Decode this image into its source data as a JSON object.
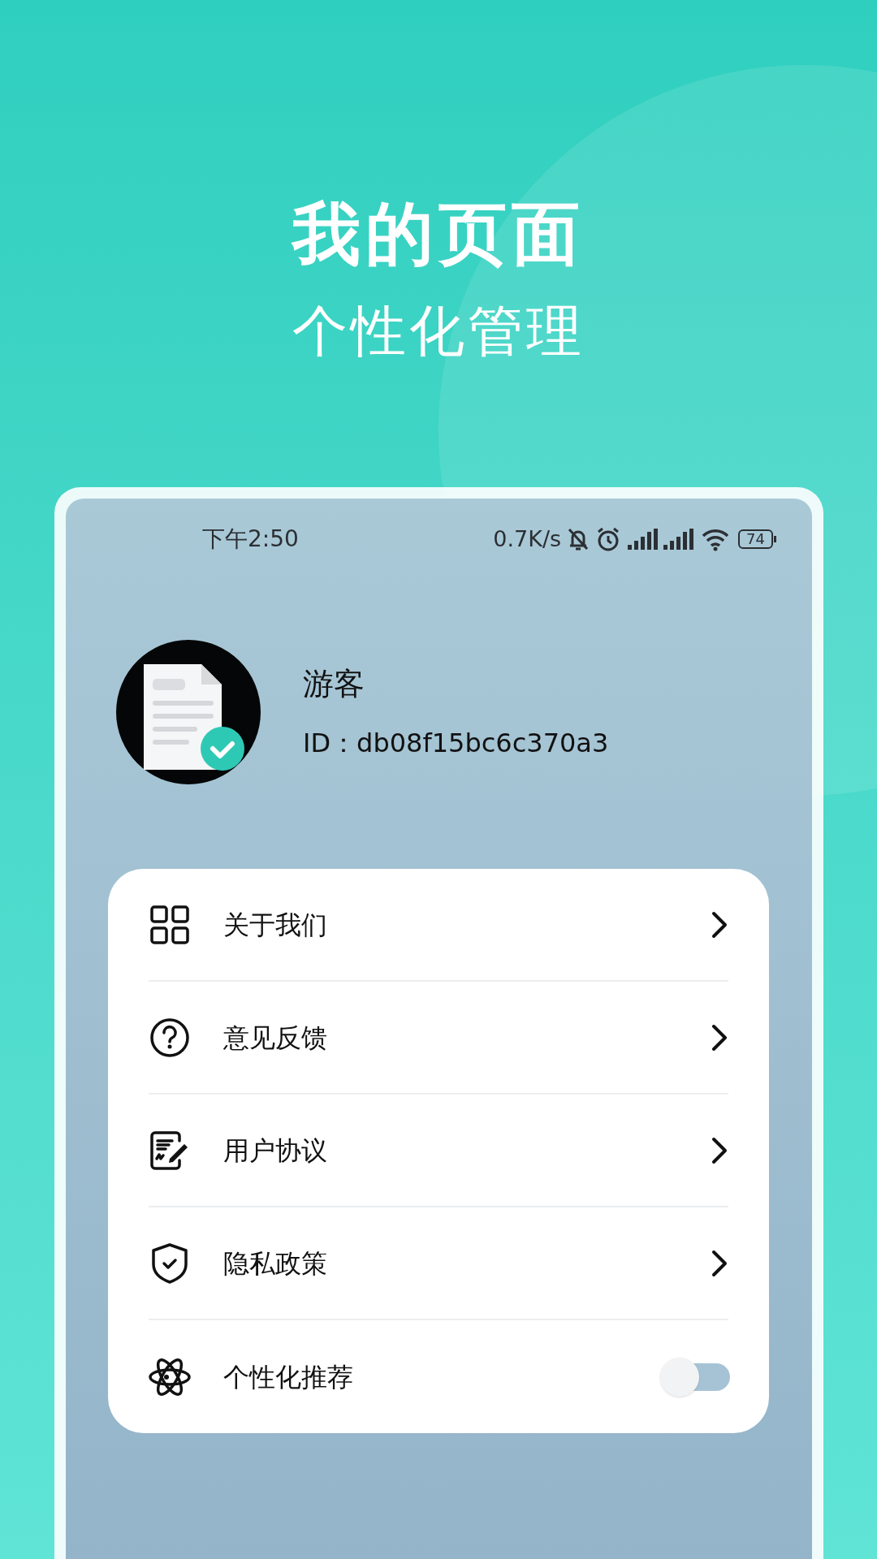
{
  "headline": "我的页面",
  "subheadline": "个性化管理",
  "status_bar": {
    "time": "下午2:50",
    "speed": "0.7K/s",
    "battery": "74"
  },
  "profile": {
    "name": "游客",
    "id": "ID：db08f15bc6c370a3"
  },
  "menu": [
    {
      "kind": "link",
      "label": "关于我们"
    },
    {
      "kind": "link",
      "label": "意见反馈"
    },
    {
      "kind": "link",
      "label": "用户协议"
    },
    {
      "kind": "link",
      "label": "隐私政策"
    },
    {
      "kind": "toggle",
      "label": "个性化推荐",
      "on": false
    }
  ]
}
